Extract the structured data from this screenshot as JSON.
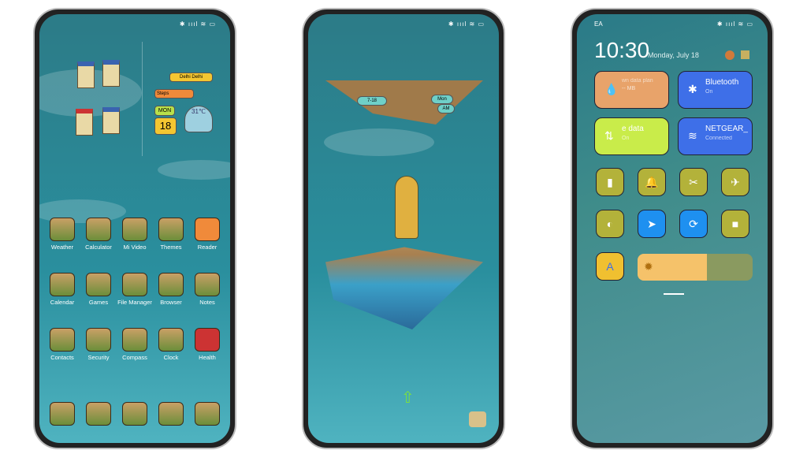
{
  "phone1": {
    "status": "✱ ıııl ≋ ▭",
    "widgets": {
      "city": "Delhi Delhi",
      "steps": "Steps",
      "day": "MON",
      "date": "18",
      "temp": "31℃"
    },
    "apps": [
      {
        "label": "Weather"
      },
      {
        "label": "Calculator"
      },
      {
        "label": "Mi Video"
      },
      {
        "label": "Themes"
      },
      {
        "label": "Reader"
      },
      {
        "label": "Calendar"
      },
      {
        "label": "Games"
      },
      {
        "label": "File Manager"
      },
      {
        "label": "Browser"
      },
      {
        "label": "Notes"
      },
      {
        "label": "Contacts"
      },
      {
        "label": "Security"
      },
      {
        "label": "Compass"
      },
      {
        "label": "Clock"
      },
      {
        "label": "Health"
      }
    ],
    "dock": [
      "phone",
      "messages",
      "gallery",
      "camera-scene",
      "camera"
    ]
  },
  "phone2": {
    "status": "✱ ıııl ≋ ▭",
    "date": "7-18",
    "day": "Mon",
    "ampm": "AM",
    "unlock_arrow": "⇧"
  },
  "phone3": {
    "status_left": "EA",
    "status": "✱ ıııl ≋ ▭",
    "time": "10:30",
    "date": "Monday, July 18",
    "tiles": [
      {
        "title": "wn data plan",
        "sub": "-- MB",
        "icon": "💧",
        "color": "#e8a36a"
      },
      {
        "title": "Bluetooth",
        "sub": "On",
        "icon": "✱",
        "color": "#3e6fe8"
      },
      {
        "title": "e data",
        "sub": "On",
        "icon": "⇅",
        "color": "#c9ec4a"
      },
      {
        "title": "NETGEAR_",
        "sub": "Connected",
        "icon": "≋",
        "color": "#3e6fe8"
      }
    ],
    "toggles": [
      {
        "name": "flashlight",
        "icon": "▮"
      },
      {
        "name": "notifications",
        "icon": "🔔"
      },
      {
        "name": "screenshot",
        "icon": "✂"
      },
      {
        "name": "airplane-mode",
        "icon": "✈"
      },
      {
        "name": "dark-mode",
        "icon": "◐"
      },
      {
        "name": "location",
        "icon": "➤"
      },
      {
        "name": "auto-rotate",
        "icon": "⟳"
      },
      {
        "name": "video-recorder",
        "icon": "■"
      }
    ],
    "font_button": "A",
    "brightness": 0.6,
    "accent": "#3e6fe8"
  }
}
